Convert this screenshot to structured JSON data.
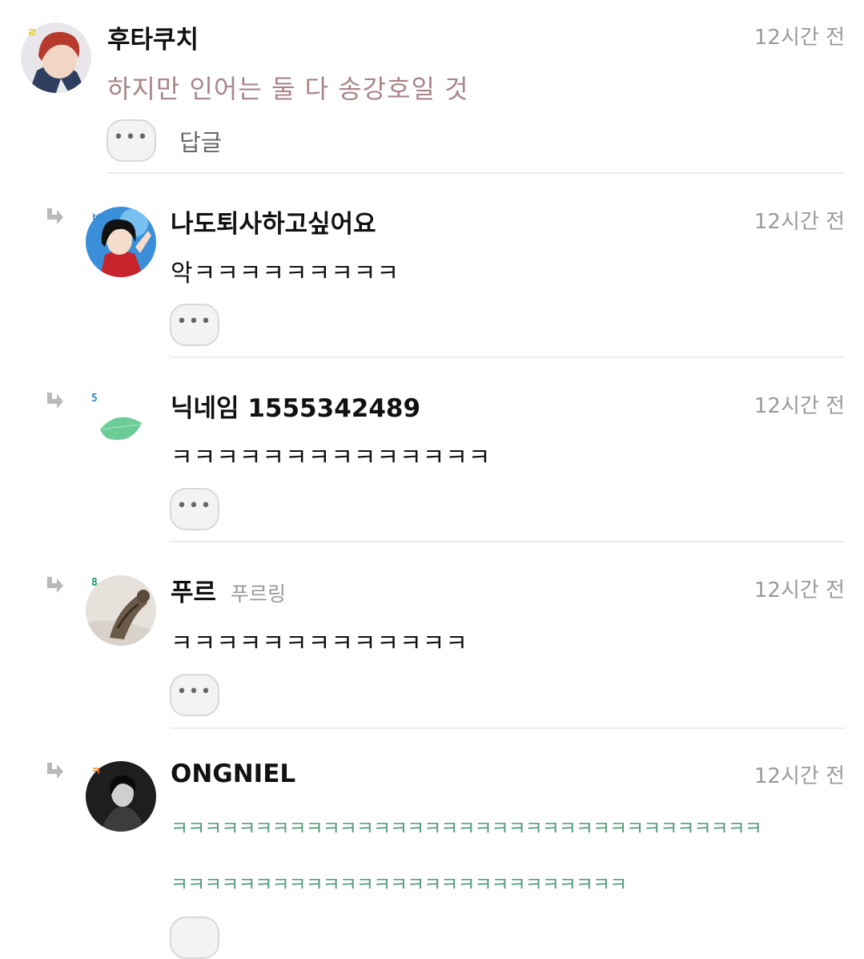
{
  "comments": [
    {
      "author": "후타쿠치",
      "level": "ㄹ",
      "time": "12시간 전",
      "text": "하지만 인어는 둘 다 송강호일 것",
      "text_color": "#a88588",
      "more": "•••",
      "reply_label": "답글"
    },
    {
      "author": "나도퇴사하고싶어요",
      "level": "ㅂ",
      "time": "12시간 전",
      "text": "악ㅋㅋㅋㅋㅋㅋㅋㅋㅋ",
      "more": "•••"
    },
    {
      "author": "닉네임 1555342489",
      "level": "5",
      "time": "12시간 전",
      "text": "ㅋㅋㅋㅋㅋㅋㅋㅋㅋㅋㅋㅋㅋㅋ",
      "more": "•••"
    },
    {
      "author": "푸르",
      "subname": "푸르링",
      "level": "8",
      "time": "12시간 전",
      "text": "ㅋㅋㅋㅋㅋㅋㅋㅋㅋㅋㅋㅋㅋ",
      "more": "•••"
    },
    {
      "author": "ONGNIEL",
      "level": "ㅋ",
      "time": "12시간 전",
      "text_line1": "ㅋㅋㅋㅋㅋㅋㅋㅋㅋㅋㅋㅋㅋㅋㅋㅋㅋㅋㅋㅋㅋㅋㅋㅋㅋㅋㅋㅋㅋㅋㅋㅋㅋㅋㅋ",
      "text_line2": "ㅋㅋㅋㅋㅋㅋㅋㅋㅋㅋㅋㅋㅋㅋㅋㅋㅋㅋㅋㅋㅋㅋㅋㅋㅋㅋㅋ",
      "text_color": "#5a9e7e"
    }
  ]
}
